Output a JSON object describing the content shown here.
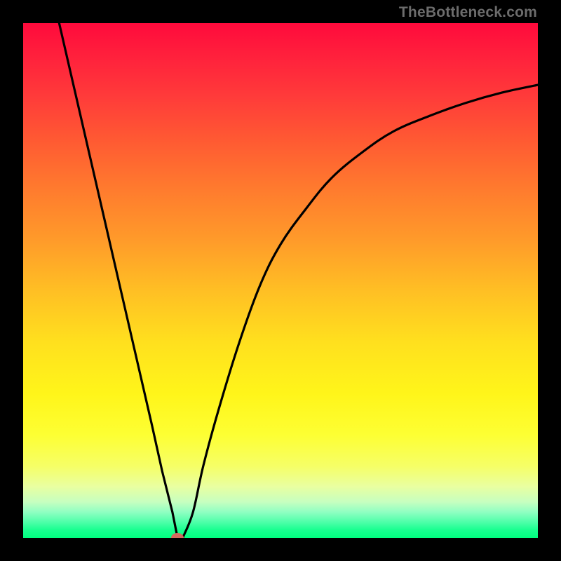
{
  "watermark": "TheBottleneck.com",
  "colors": {
    "background": "#000000",
    "curve": "#000000",
    "vertex_dot": "#d46a5e",
    "gradient_top": "#ff0a3c",
    "gradient_bottom": "#00ff80"
  },
  "chart_data": {
    "type": "line",
    "title": "",
    "xlabel": "",
    "ylabel": "",
    "xlim": [
      0,
      100
    ],
    "ylim": [
      0,
      100
    ],
    "annotations": [
      {
        "name": "gradient-background",
        "description": "vertical gradient from red (top) through orange, yellow to green (bottom)"
      },
      {
        "name": "vertex-marker",
        "x": 30,
        "y": 0,
        "color": "#d46a5e"
      }
    ],
    "series": [
      {
        "name": "bottleneck-curve",
        "x": [
          7,
          10,
          13,
          16,
          19,
          22,
          25,
          27,
          29,
          30,
          31,
          33,
          35,
          38,
          42,
          46,
          50,
          55,
          60,
          66,
          72,
          79,
          86,
          93,
          100
        ],
        "y": [
          100,
          87,
          74,
          61,
          48,
          35,
          22,
          13,
          5,
          0,
          0,
          5,
          14,
          25,
          38,
          49,
          57,
          64,
          70,
          75,
          79,
          82,
          84.5,
          86.5,
          88
        ]
      }
    ]
  }
}
